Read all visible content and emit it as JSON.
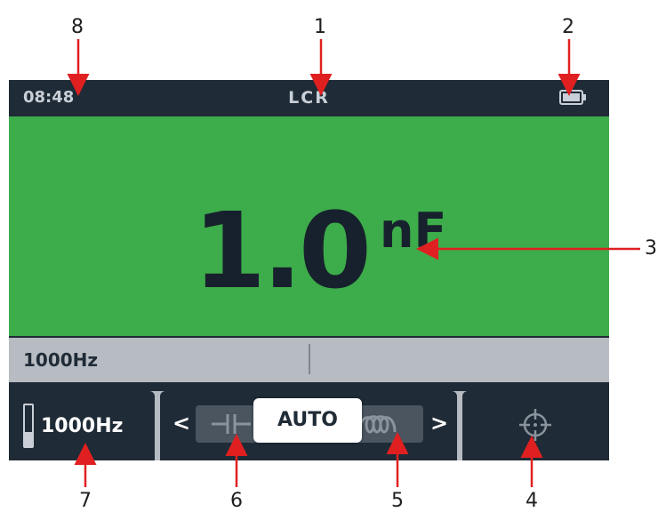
{
  "status_bar": {
    "time": "08:48",
    "mode": "LCR"
  },
  "reading": {
    "value": "1.0",
    "unit": "nF"
  },
  "secondary": {
    "frequency": "1000Hz"
  },
  "softkeys": {
    "frequency": {
      "label": "1000Hz",
      "level_fraction": 0.35
    },
    "mode_selector": {
      "label": "AUTO",
      "left_arrow": "<",
      "right_arrow": ">"
    },
    "target_icon": "crosshair-icon"
  },
  "callouts": [
    "1",
    "2",
    "3",
    "4",
    "5",
    "6",
    "7",
    "8"
  ],
  "colors": {
    "screen_dark": "#1f2b36",
    "reading_green": "#3dac4a",
    "secondary_grey": "#b7bcc2",
    "callout_red": "#e02020"
  }
}
